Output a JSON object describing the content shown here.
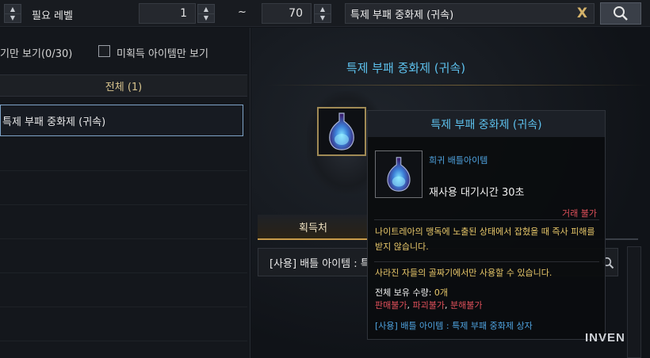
{
  "topbar": {
    "level_label": "필요 레벨",
    "level_min": "1",
    "tilde": "~",
    "level_max": "70",
    "search_value": "특제 부패 중화제 (귀속)",
    "clear_glyph": "X",
    "search_icon": "search-icon"
  },
  "left": {
    "filter_owned": "기만 보기(0/30)",
    "filter_unowned": "미획득 아이템만 보기",
    "category": "전체 (1)",
    "selected_item": "특제 부패 중화제 (귀속)"
  },
  "right": {
    "title": "특제 부패 중화제 (귀속)",
    "tab_source": "획득처",
    "source_row": "[사용] 배틀 아이템 : 특"
  },
  "tooltip": {
    "title": "특제 부패 중화제 (귀속)",
    "grade": "희귀 배틀아이템",
    "cooldown": "재사용 대기시간 30초",
    "trade": "거래 불가",
    "description": "나이트레아의 맹독에 노출된 상태에서 잡혔을 때 즉사 피해를 받지 않습니다.",
    "usable_only": "사라진 자들의 골짜기에서만 사용할 수 있습니다.",
    "owned_label": "전체 보유 수량: ",
    "owned_count": "0개",
    "restr_sell": "판매불가",
    "restr_comma1": ", ",
    "restr_destroy": "파괴불가",
    "restr_comma2": ", ",
    "restr_dismantle": "분해불가",
    "use_source": "[사용] 배틀 아이템 : 특제 부패 중화제 상자"
  },
  "watermark": "INVEN",
  "colors": {
    "accent_blue": "#5dc0ec",
    "gold": "#e8c86a",
    "red": "#e0505a"
  }
}
